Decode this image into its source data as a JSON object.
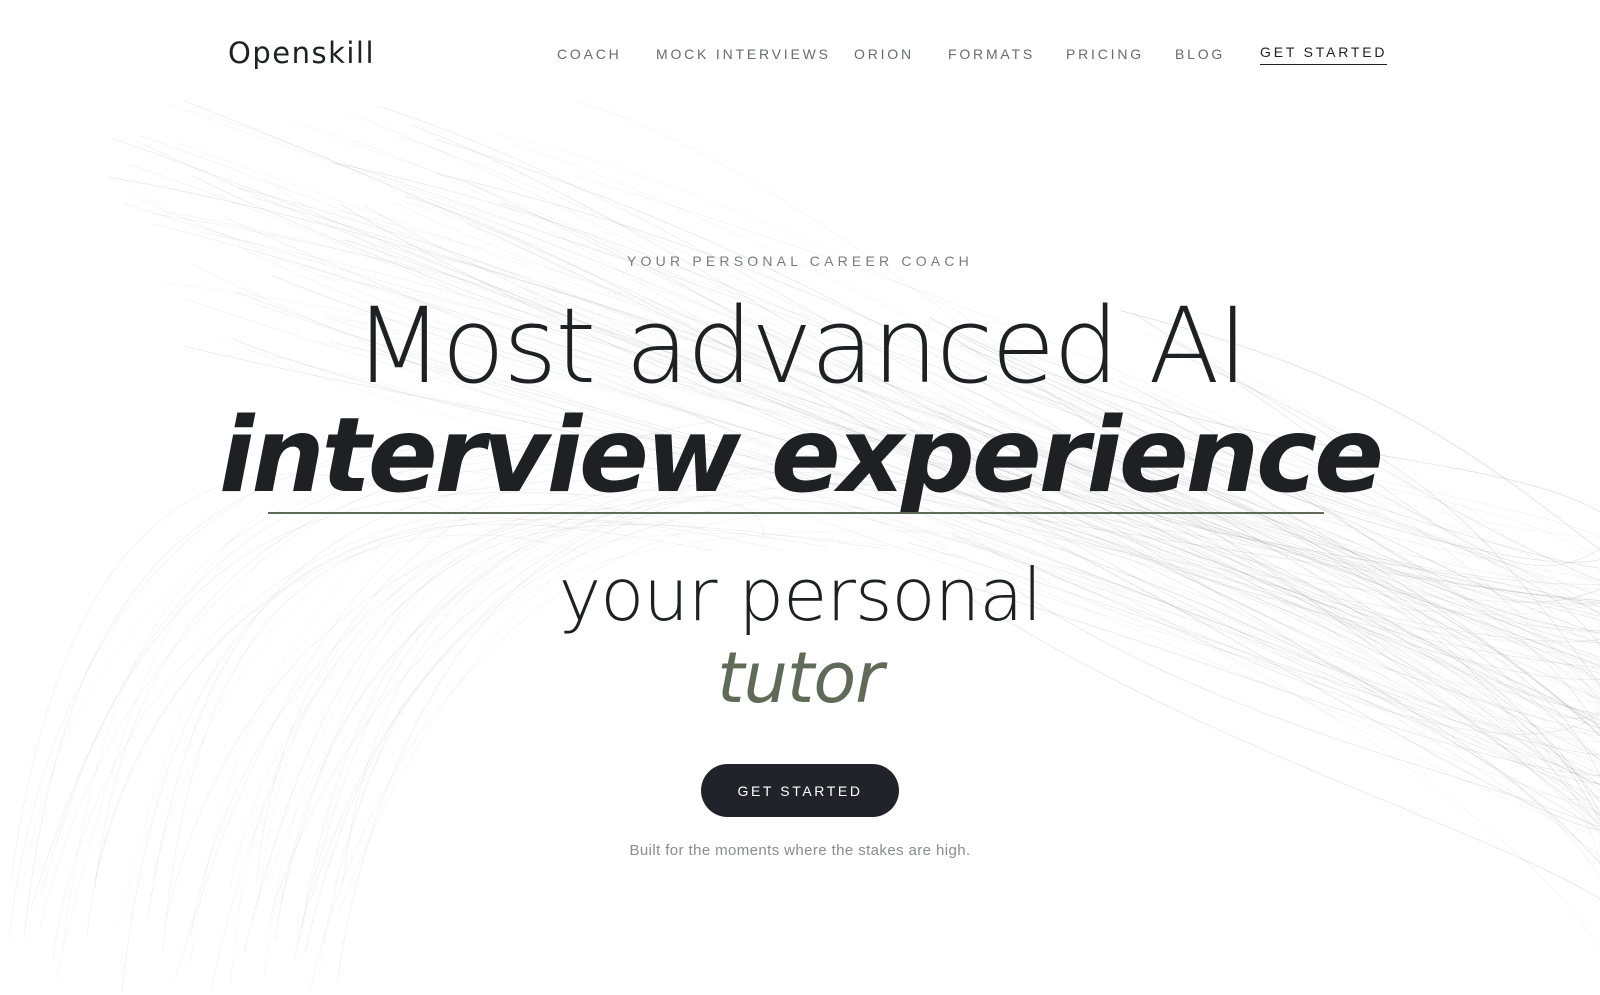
{
  "brand": {
    "logo_text": "Openskill"
  },
  "nav": {
    "items": [
      {
        "label": "COACH"
      },
      {
        "label": "MOCK INTERVIEWS"
      },
      {
        "label": "ORION"
      },
      {
        "label": "FORMATS"
      },
      {
        "label": "PRICING"
      },
      {
        "label": "BLOG"
      }
    ],
    "cta_label": "GET STARTED"
  },
  "hero": {
    "eyebrow": "YOUR PERSONAL CAREER COACH",
    "headline_line1": "Most advanced AI",
    "headline_line2": "interview experience",
    "subheadline_line1": "your personal",
    "subheadline_line2": "tutor",
    "cta_label": "GET STARTED",
    "tagline": "Built for the moments where the stakes are high."
  },
  "colors": {
    "text_primary": "#1f2024",
    "text_muted": "#6a6b70",
    "accent_olive": "#5f6b57",
    "button_bg": "#22232a",
    "background": "#ffffff"
  }
}
